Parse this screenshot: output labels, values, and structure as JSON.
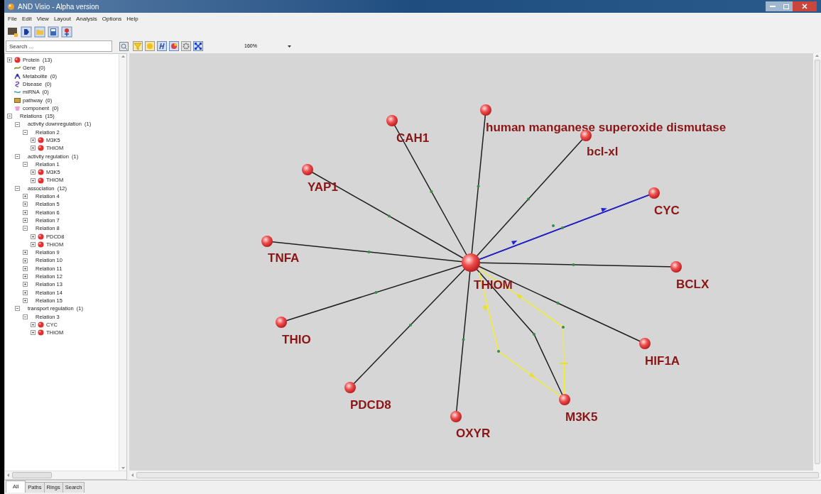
{
  "window": {
    "title": "AND Visio - Alpha version"
  },
  "menu": [
    "File",
    "Edit",
    "View",
    "Layout",
    "Analysis",
    "Options",
    "Help"
  ],
  "search": {
    "placeholder": "Search ..."
  },
  "zoom": {
    "value": "160%"
  },
  "tree": [
    {
      "label": "Protein  (13)",
      "kind": "protein",
      "expanded": false
    },
    {
      "label": "Gene  (0)",
      "kind": "gene"
    },
    {
      "label": "Metabolite  (0)",
      "kind": "metabolite"
    },
    {
      "label": "Disease  (0)",
      "kind": "disease"
    },
    {
      "label": "miRNA  (0)",
      "kind": "mirna"
    },
    {
      "label": "pathway  (0)",
      "kind": "pathway"
    },
    {
      "label": "component  (0)",
      "kind": "component"
    },
    {
      "label": "Relations  (15)",
      "expanded": true,
      "children": [
        {
          "label": "activity downregulation  (1)",
          "expanded": true,
          "children": [
            {
              "label": "Relation 2",
              "expanded": true,
              "children": [
                {
                  "label": "M3K5",
                  "kind": "protein",
                  "expanded": false
                },
                {
                  "label": "THIOM",
                  "kind": "protein",
                  "expanded": false
                }
              ]
            }
          ]
        },
        {
          "label": "activity regulation  (1)",
          "expanded": true,
          "children": [
            {
              "label": "Relation 1",
              "expanded": true,
              "children": [
                {
                  "label": "M3K5",
                  "kind": "protein",
                  "expanded": false
                },
                {
                  "label": "THIOM",
                  "kind": "protein",
                  "expanded": false
                }
              ]
            }
          ]
        },
        {
          "label": "association  (12)",
          "expanded": true,
          "children": [
            {
              "label": "Relation 4",
              "expanded": false
            },
            {
              "label": "Relation 5",
              "expanded": false
            },
            {
              "label": "Relation 6",
              "expanded": false
            },
            {
              "label": "Relation 7",
              "expanded": false
            },
            {
              "label": "Relation 8",
              "expanded": true,
              "children": [
                {
                  "label": "PDCD8",
                  "kind": "protein",
                  "expanded": false
                },
                {
                  "label": "THIOM",
                  "kind": "protein",
                  "expanded": false
                }
              ]
            },
            {
              "label": "Relation 9",
              "expanded": false
            },
            {
              "label": "Relation 10",
              "expanded": false
            },
            {
              "label": "Relation 11",
              "expanded": false
            },
            {
              "label": "Relation 12",
              "expanded": false
            },
            {
              "label": "Relation 13",
              "expanded": false
            },
            {
              "label": "Relation 14",
              "expanded": false
            },
            {
              "label": "Relation 15",
              "expanded": false
            }
          ]
        },
        {
          "label": "transport regulation  (1)",
          "expanded": true,
          "children": [
            {
              "label": "Relation 3",
              "expanded": true,
              "children": [
                {
                  "label": "CYC",
                  "kind": "protein",
                  "expanded": false
                },
                {
                  "label": "THIOM",
                  "kind": "protein",
                  "expanded": false
                }
              ]
            }
          ]
        }
      ]
    }
  ],
  "graph": {
    "nodes": [
      {
        "label": "THIOM"
      },
      {
        "label": "CAH1"
      },
      {
        "label": "human manganese superoxide dismutase"
      },
      {
        "label": "bcl-xl"
      },
      {
        "label": "YAP1"
      },
      {
        "label": "CYC"
      },
      {
        "label": "TNFA"
      },
      {
        "label": "BCLX"
      },
      {
        "label": "THIO"
      },
      {
        "label": "HIF1A"
      },
      {
        "label": "PDCD8"
      },
      {
        "label": "OXYR"
      },
      {
        "label": "M3K5"
      }
    ]
  },
  "tabs": [
    {
      "label": "All",
      "selected": true
    },
    {
      "label": "Paths",
      "selected": false
    },
    {
      "label": "Rings",
      "selected": false
    },
    {
      "label": "Search",
      "selected": false
    }
  ]
}
